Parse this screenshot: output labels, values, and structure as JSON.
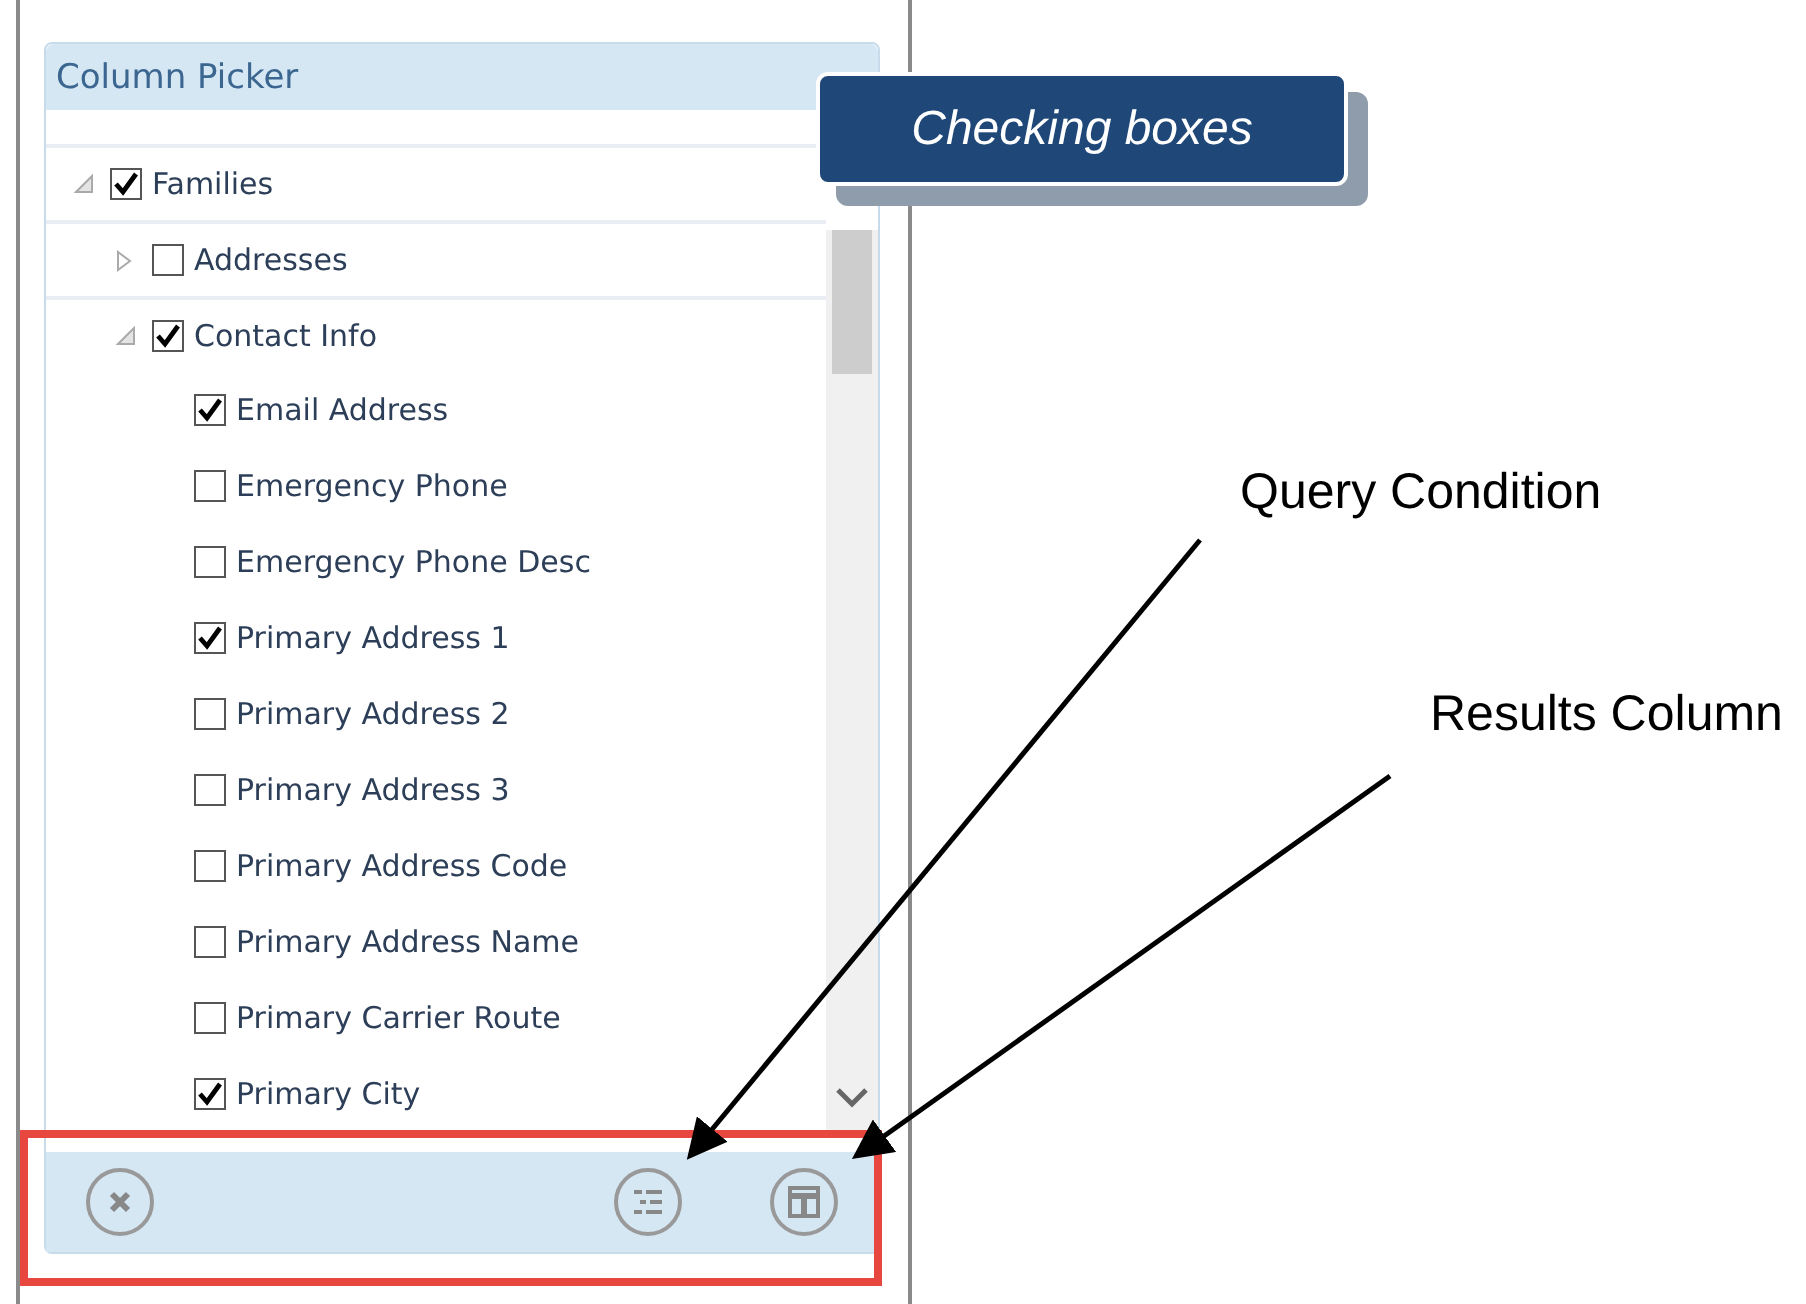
{
  "panel": {
    "title": "Column Picker"
  },
  "tree": [
    {
      "label": "Families",
      "checked": true,
      "expanded": true,
      "children": [
        {
          "label": "Addresses",
          "checked": false,
          "expanded": false
        },
        {
          "label": "Contact Info",
          "checked": true,
          "expanded": true,
          "children": [
            {
              "label": "Email Address",
              "checked": true
            },
            {
              "label": "Emergency Phone",
              "checked": false
            },
            {
              "label": "Emergency Phone Desc",
              "checked": false
            },
            {
              "label": "Primary Address 1",
              "checked": true
            },
            {
              "label": "Primary Address 2",
              "checked": false
            },
            {
              "label": "Primary Address 3",
              "checked": false
            },
            {
              "label": "Primary Address Code",
              "checked": false
            },
            {
              "label": "Primary Address Name",
              "checked": false
            },
            {
              "label": "Primary Carrier Route",
              "checked": false
            },
            {
              "label": "Primary City",
              "checked": true
            }
          ]
        }
      ]
    }
  ],
  "toolbar": [
    {
      "kind": "clear"
    },
    {
      "kind": "query"
    },
    {
      "kind": "column"
    }
  ],
  "callout": {
    "text": "Checking boxes"
  },
  "annotations": [
    {
      "text": "Query Condition"
    },
    {
      "text": "Results Column"
    }
  ]
}
